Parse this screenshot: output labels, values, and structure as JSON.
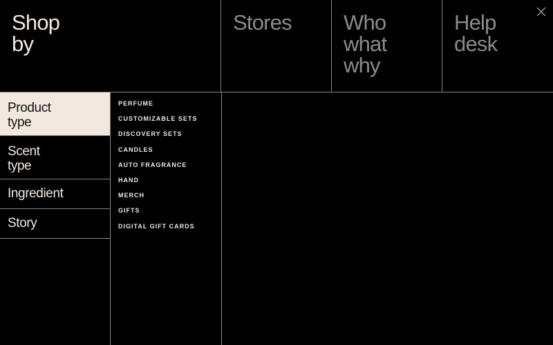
{
  "header": {
    "shop_by": "Shop\nby",
    "nav": [
      {
        "label": "Stores"
      },
      {
        "label": "Who\nwhat\nwhy"
      },
      {
        "label": "Help\ndesk"
      }
    ],
    "close_icon": "close-icon"
  },
  "categories": {
    "active_index": 0,
    "items": [
      {
        "label": "Product\ntype"
      },
      {
        "label": "Scent\ntype"
      },
      {
        "label": "Ingredient"
      },
      {
        "label": "Story"
      }
    ]
  },
  "subcategories": {
    "items": [
      "Perfume",
      "Customizable Sets",
      "Discovery Sets",
      "Candles",
      "Auto Fragrance",
      "Hand",
      "Merch",
      "Gifts",
      "Digital Gift Cards"
    ]
  },
  "colors": {
    "background": "#000000",
    "text_light": "#f2e8df",
    "text_muted": "#8e8a86",
    "active_bg": "#f2e8df",
    "divider": "#8a8580"
  }
}
